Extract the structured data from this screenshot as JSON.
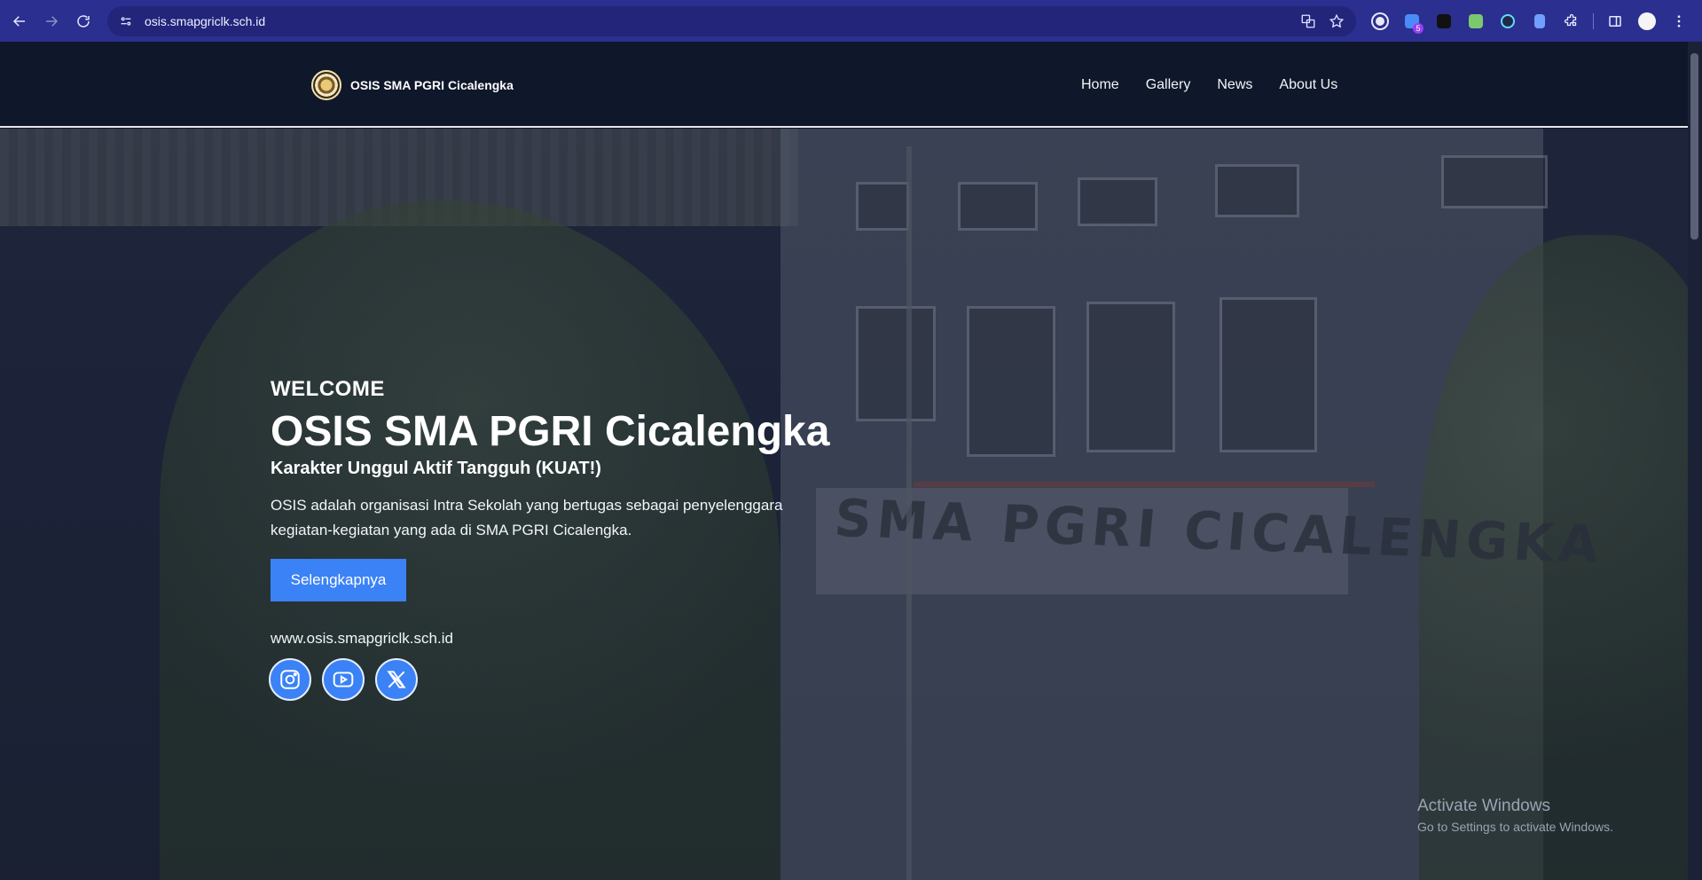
{
  "browser": {
    "url": "osis.smapgriclk.sch.id",
    "extension_badge": "5"
  },
  "site": {
    "brand_name": "OSIS SMA PGRI Cicalengka",
    "nav": [
      "Home",
      "Gallery",
      "News",
      "About Us"
    ]
  },
  "hero": {
    "welcome": "WELCOME",
    "title": "OSIS SMA PGRI Cicalengka",
    "tagline": "Karakter Unggul Aktif Tangguh (KUAT!)",
    "description": "OSIS adalah organisasi Intra Sekolah yang bertugas sebagai penyelenggara kegiatan-kegiatan yang ada di SMA PGRI Cicalengka.",
    "cta_label": "Selengkapnya",
    "website": "www.osis.smapgriclk.sch.id",
    "socials": [
      "instagram-icon",
      "youtube-icon",
      "x-icon"
    ],
    "background_sign": "SMA PGRI CICALENGKA"
  },
  "watermark": {
    "title": "Activate Windows",
    "subtitle": "Go to Settings to activate Windows."
  },
  "colors": {
    "browser_frame": "#2b2f8f",
    "header_bg": "#0f172a",
    "accent": "#3b82f6"
  }
}
